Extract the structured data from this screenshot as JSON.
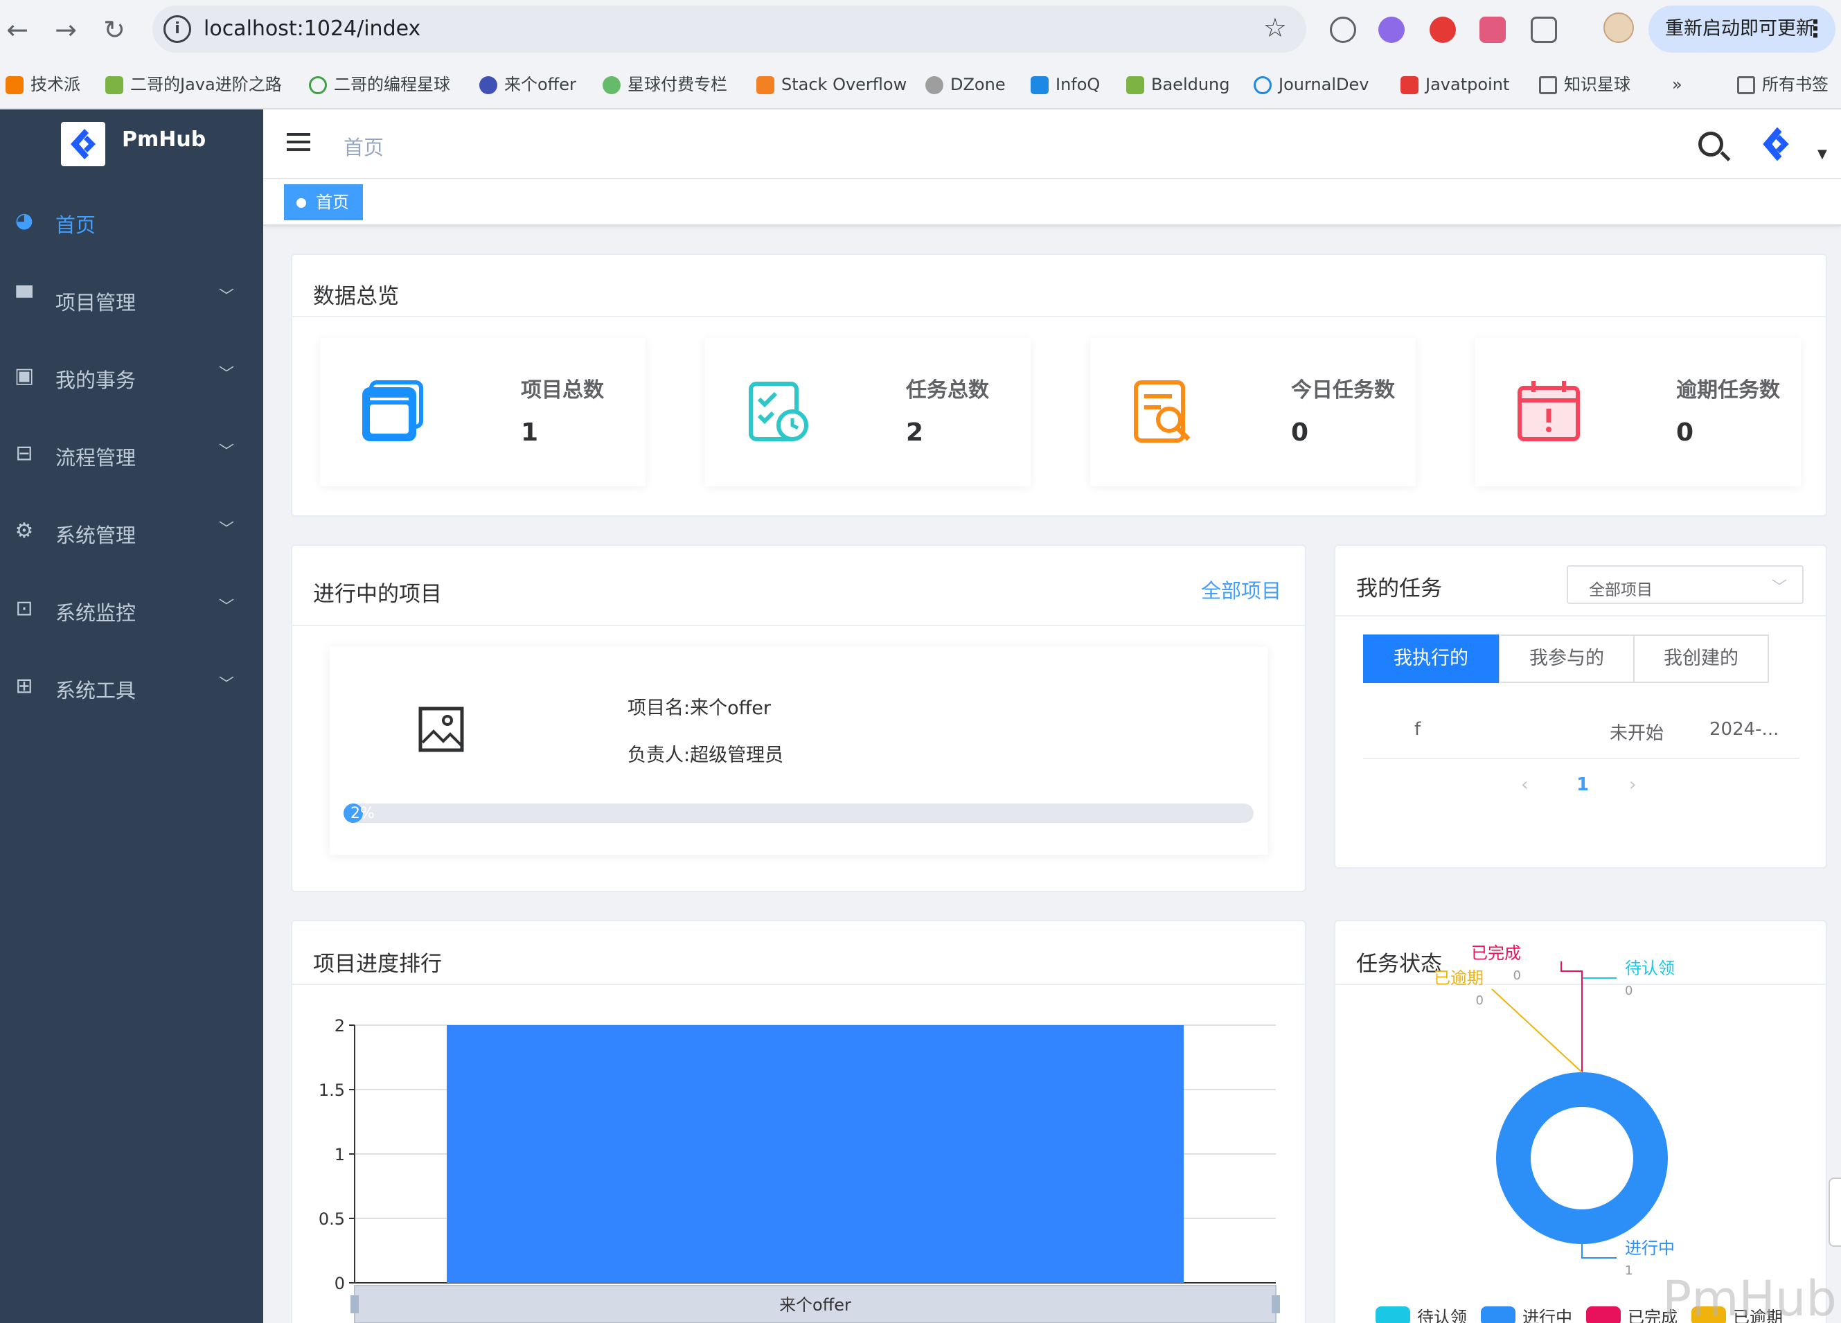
{
  "browser": {
    "url": "localhost:1024/index",
    "update_label": "重新启动即可更新",
    "bookmarks": [
      "技术派",
      "二哥的Java进阶之路",
      "二哥的编程星球",
      "来个offer",
      "星球付费专栏",
      "Stack Overflow",
      "DZone",
      "InfoQ",
      "Baeldung",
      "JournalDev",
      "Javatpoint",
      "知识星球",
      "»",
      "所有书签"
    ]
  },
  "app": {
    "name": "PmHub"
  },
  "sidebar": {
    "items": [
      {
        "label": "首页",
        "icon": "dashboard-icon"
      },
      {
        "label": "项目管理",
        "icon": "folder-icon"
      },
      {
        "label": "我的事务",
        "icon": "document-icon"
      },
      {
        "label": "流程管理",
        "icon": "flow-icon"
      },
      {
        "label": "系统管理",
        "icon": "gear-icon"
      },
      {
        "label": "系统监控",
        "icon": "monitor-icon"
      },
      {
        "label": "系统工具",
        "icon": "toolbox-icon"
      }
    ]
  },
  "navbar": {
    "breadcrumb": "首页",
    "tag": "首页"
  },
  "overview": {
    "title": "数据总览",
    "stats": [
      {
        "label": "项目总数",
        "value": "1",
        "color": "#1890ff"
      },
      {
        "label": "任务总数",
        "value": "2",
        "color": "#2ec7c9"
      },
      {
        "label": "今日任务数",
        "value": "0",
        "color": "#fa8c16"
      },
      {
        "label": "逾期任务数",
        "value": "0",
        "color": "#f5455c"
      }
    ]
  },
  "projects": {
    "title": "进行中的项目",
    "link": "全部项目",
    "item": {
      "name_line": "项目名:来个offer",
      "owner_line": "负责人:超级管理员",
      "progress": 0.02,
      "progress_label": "2%"
    }
  },
  "my_tasks": {
    "title": "我的任务",
    "filter": "全部项目",
    "tabs": [
      "我执行的",
      "我参与的",
      "我创建的"
    ],
    "rows": [
      {
        "name": "f",
        "status": "未开始",
        "date": "2024-..."
      }
    ],
    "pager": {
      "prev": "‹",
      "page": "1",
      "next": "›"
    }
  },
  "ranking": {
    "title": "项目进度排行"
  },
  "task_status": {
    "title": "任务状态",
    "legend": [
      "待认领",
      "进行中",
      "已完成",
      "已逾期"
    ]
  },
  "chart_data": [
    {
      "type": "bar",
      "categories": [
        "来个offer"
      ],
      "values": [
        2
      ],
      "ylim": [
        0,
        2
      ],
      "yticks": [
        "0",
        "0.5",
        "1",
        "1.5",
        "2"
      ],
      "color": "#3385ff",
      "grid": true
    },
    {
      "type": "pie",
      "labels": [
        "待认领",
        "进行中",
        "已完成",
        "已逾期"
      ],
      "values": [
        0,
        1,
        0,
        0
      ],
      "colors": [
        "#1ac8e6",
        "#2b8ff7",
        "#e8125c",
        "#f0b30c"
      ],
      "donut": true,
      "legend": "bottom"
    }
  ],
  "watermark": "PmHub"
}
